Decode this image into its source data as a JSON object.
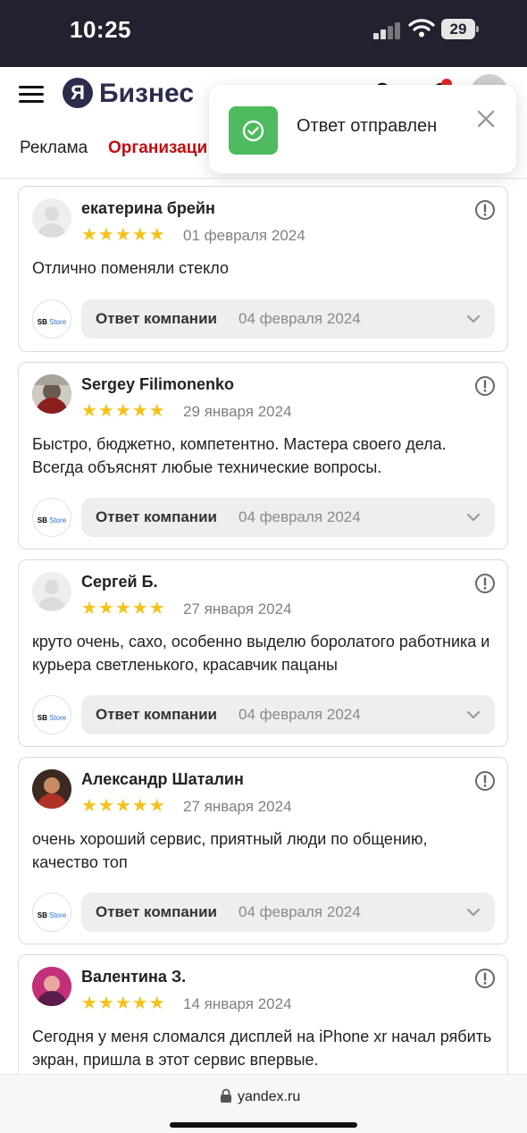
{
  "status_bar": {
    "time": "10:25",
    "battery": "29"
  },
  "header": {
    "brand_letter": "Я",
    "brand_name": "Бизнес",
    "nav": [
      {
        "label": "Реклама",
        "active": false
      },
      {
        "label": "Организаци",
        "active": true
      }
    ],
    "accent_color": "#c00d10"
  },
  "toast": {
    "message": "Ответ отправлен",
    "color": "#4dbb5e"
  },
  "reviews": [
    {
      "author": "екатерина брейн",
      "rating": 5,
      "stars": "★★★★★",
      "date": "01 февраля 2024",
      "text": "Отлично поменяли стекло",
      "reply_label": "Ответ компании",
      "reply_date": "04 февраля 2024"
    },
    {
      "author": "Sergey Filimonenko",
      "rating": 5,
      "stars": "★★★★★",
      "date": "29 января 2024",
      "text": "Быстро, бюджетно, компетентно. Мастера своего дела. Всегда объяснят любые технические вопросы.",
      "reply_label": "Ответ компании",
      "reply_date": "04 февраля 2024"
    },
    {
      "author": "Сергей Б.",
      "rating": 5,
      "stars": "★★★★★",
      "date": "27 января 2024",
      "text": "круто очень, сахо, особенно выделю боролатого работника и курьера светленького, красавчик пацаны",
      "reply_label": "Ответ компании",
      "reply_date": "04 февраля 2024"
    },
    {
      "author": "Александр Шаталин",
      "rating": 5,
      "stars": "★★★★★",
      "date": "27 января 2024",
      "text": "очень хороший сервис, приятный люди по общению, качество топ",
      "reply_label": "Ответ компании",
      "reply_date": "04 февраля 2024"
    },
    {
      "author": "Валентина З.",
      "rating": 5,
      "stars": "★★★★★",
      "date": "14 января 2024",
      "text": "Сегодня у меня сломался дисплей на iPhone xr начал рябить экран, пришла в этот сервис впервые."
    }
  ],
  "company_logo": {
    "apple": "",
    "name": "SB",
    "suffix": "Store"
  },
  "url_bar": {
    "url": "yandex.ru"
  }
}
